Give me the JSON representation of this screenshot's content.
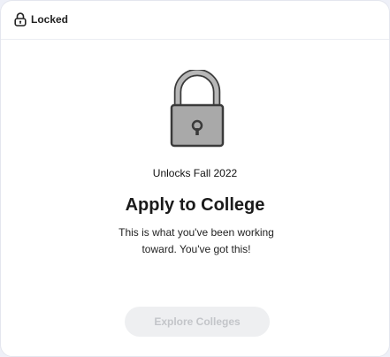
{
  "header": {
    "status_icon": "lock-icon",
    "status_label": "Locked"
  },
  "card": {
    "illustration_icon": "padlock-icon",
    "unlock_date": "Unlocks Fall 2022",
    "title": "Apply to College",
    "description": "This is what you've been working toward. You've got this!",
    "cta_label": "Explore Colleges",
    "cta_state": "disabled"
  },
  "colors": {
    "background": "#eef0f8",
    "card": "#ffffff",
    "lock_body": "#a9a9a9",
    "lock_shackle": "#b6b6b6",
    "button_disabled_bg": "#eeeff1",
    "button_disabled_text": "#c3c5c9"
  }
}
